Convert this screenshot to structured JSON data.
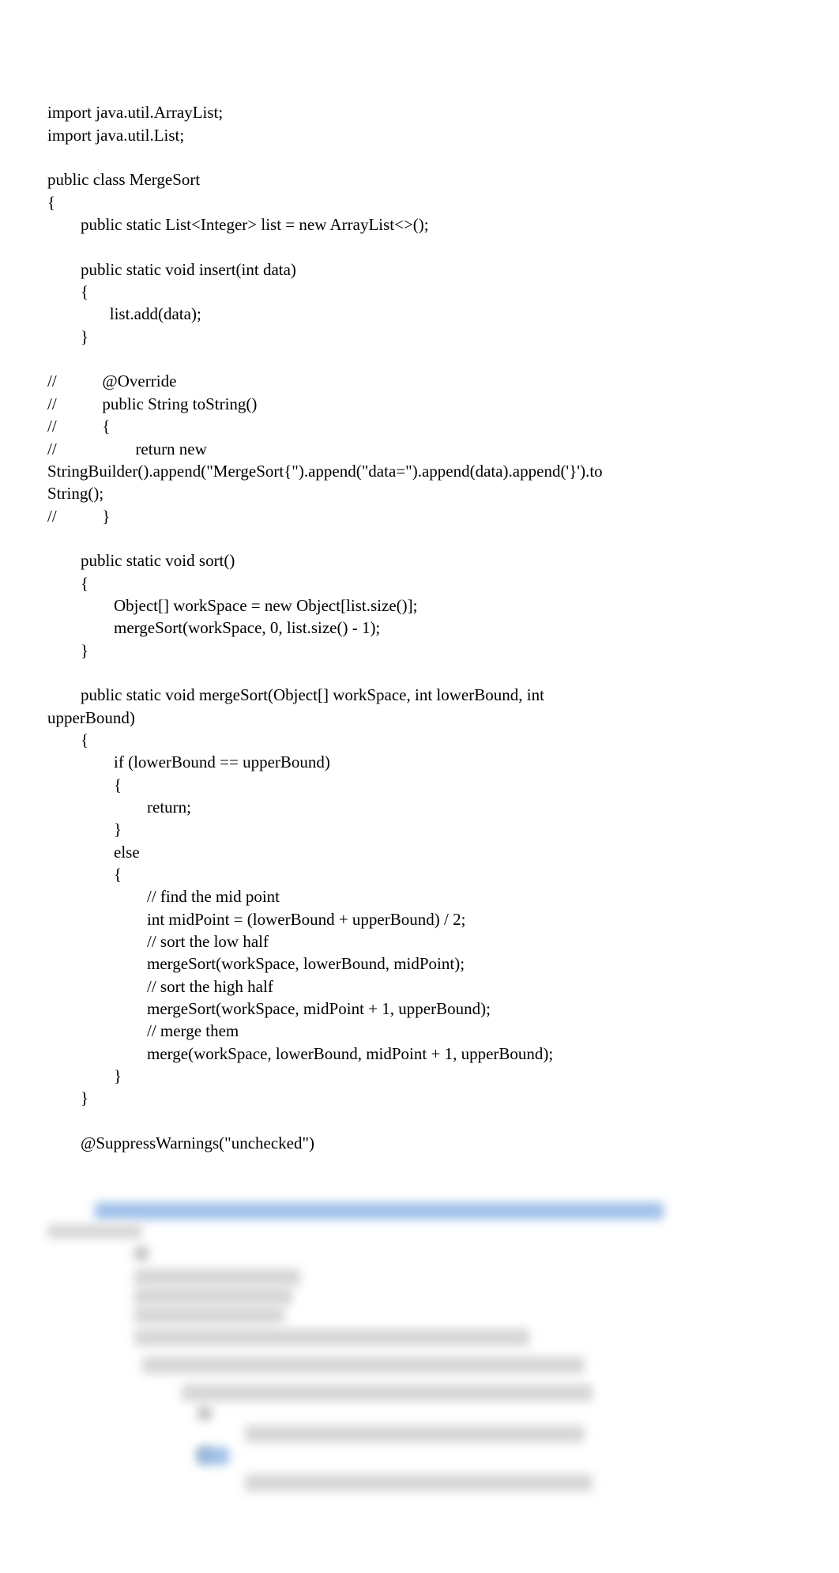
{
  "code": {
    "line01": "import java.util.ArrayList;",
    "line02": "import java.util.List;",
    "line03": "",
    "line04": "public class MergeSort",
    "line05": "{",
    "line06": "        public static List<Integer> list = new ArrayList<>();",
    "line07": "",
    "line08": "        public static void insert(int data)",
    "line09": "        {",
    "line10": "               list.add(data);",
    "line11": "        }",
    "line12": "",
    "line13": "//           @Override",
    "line14": "//           public String toString()",
    "line15": "//           {",
    "line16": "//                   return new",
    "line17": "StringBuilder().append(\"MergeSort{\").append(\"data=\").append(data).append('}').to",
    "line18": "String();",
    "line19": "//           }",
    "line20": "",
    "line21": "        public static void sort()",
    "line22": "        {",
    "line23": "                Object[] workSpace = new Object[list.size()];",
    "line24": "                mergeSort(workSpace, 0, list.size() - 1);",
    "line25": "        }",
    "line26": "",
    "line27": "        public static void mergeSort(Object[] workSpace, int lowerBound, int",
    "line28": "upperBound)",
    "line29": "        {",
    "line30": "                if (lowerBound == upperBound)",
    "line31": "                {",
    "line32": "                        return;",
    "line33": "                }",
    "line34": "                else",
    "line35": "                {",
    "line36": "                        // find the mid point",
    "line37": "                        int midPoint = (lowerBound + upperBound) / 2;",
    "line38": "                        // sort the low half",
    "line39": "                        mergeSort(workSpace, lowerBound, midPoint);",
    "line40": "                        // sort the high half",
    "line41": "                        mergeSort(workSpace, midPoint + 1, upperBound);",
    "line42": "                        // merge them",
    "line43": "                        merge(workSpace, lowerBound, midPoint + 1, upperBound);",
    "line44": "                }",
    "line45": "        }",
    "line46": "",
    "line47": "        @SuppressWarnings(\"unchecked\")"
  }
}
